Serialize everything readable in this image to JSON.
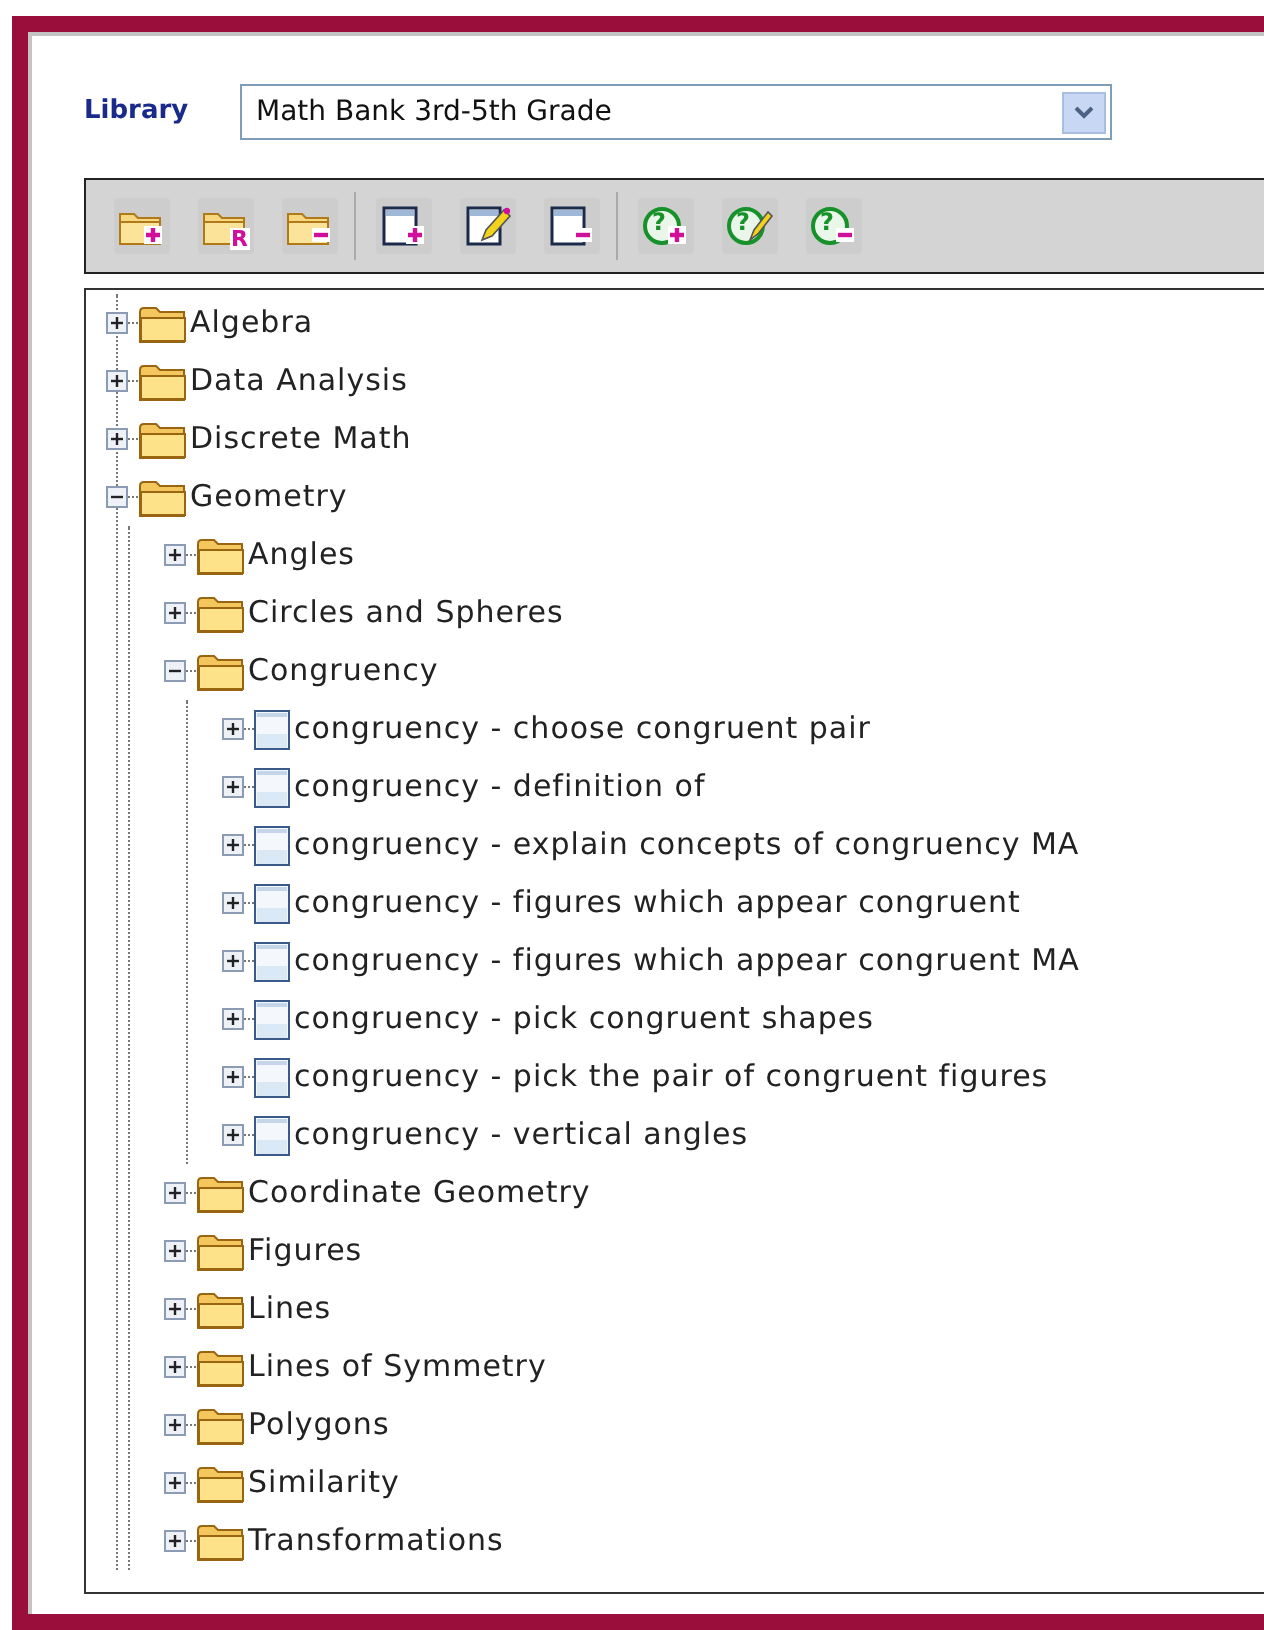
{
  "library": {
    "label": "Library",
    "value": "Math Bank 3rd-5th Grade"
  },
  "toolbar": [
    [
      {
        "kind": "folder-add"
      },
      {
        "kind": "folder-rename",
        "glyph": "R"
      },
      {
        "kind": "folder-remove"
      }
    ],
    [
      {
        "kind": "page-add"
      },
      {
        "kind": "page-edit"
      },
      {
        "kind": "page-remove"
      }
    ],
    [
      {
        "kind": "question-add",
        "glyph": "?"
      },
      {
        "kind": "question-edit",
        "glyph": "?"
      },
      {
        "kind": "question-remove",
        "glyph": "?"
      }
    ]
  ],
  "tree": [
    {
      "kind": "folder",
      "label": "Algebra",
      "expanded": false
    },
    {
      "kind": "folder",
      "label": "Data Analysis",
      "expanded": false
    },
    {
      "kind": "folder",
      "label": "Discrete Math",
      "expanded": false
    },
    {
      "kind": "folder",
      "label": "Geometry",
      "expanded": true,
      "children": [
        {
          "kind": "folder",
          "label": "Angles",
          "expanded": false
        },
        {
          "kind": "folder",
          "label": "Circles and Spheres",
          "expanded": false
        },
        {
          "kind": "folder",
          "label": "Congruency",
          "expanded": true,
          "children": [
            {
              "kind": "item",
              "label": "congruency - choose congruent pair",
              "expanded": false
            },
            {
              "kind": "item",
              "label": "congruency - definition of",
              "expanded": false
            },
            {
              "kind": "item",
              "label": "congruency - explain concepts of congruency MA",
              "expanded": false
            },
            {
              "kind": "item",
              "label": "congruency - figures which appear congruent",
              "expanded": false
            },
            {
              "kind": "item",
              "label": "congruency - figures which appear congruent MA",
              "expanded": false
            },
            {
              "kind": "item",
              "label": "congruency - pick congruent shapes",
              "expanded": false
            },
            {
              "kind": "item",
              "label": "congruency - pick the pair of congruent figures",
              "expanded": false
            },
            {
              "kind": "item",
              "label": "congruency - vertical angles",
              "expanded": false
            }
          ]
        },
        {
          "kind": "folder",
          "label": "Coordinate Geometry",
          "expanded": false
        },
        {
          "kind": "folder",
          "label": "Figures",
          "expanded": false
        },
        {
          "kind": "folder",
          "label": "Lines",
          "expanded": false
        },
        {
          "kind": "folder",
          "label": "Lines of Symmetry",
          "expanded": false
        },
        {
          "kind": "folder",
          "label": "Polygons",
          "expanded": false
        },
        {
          "kind": "folder",
          "label": "Similarity",
          "expanded": false
        },
        {
          "kind": "folder",
          "label": "Transformations",
          "expanded": false
        }
      ]
    }
  ]
}
